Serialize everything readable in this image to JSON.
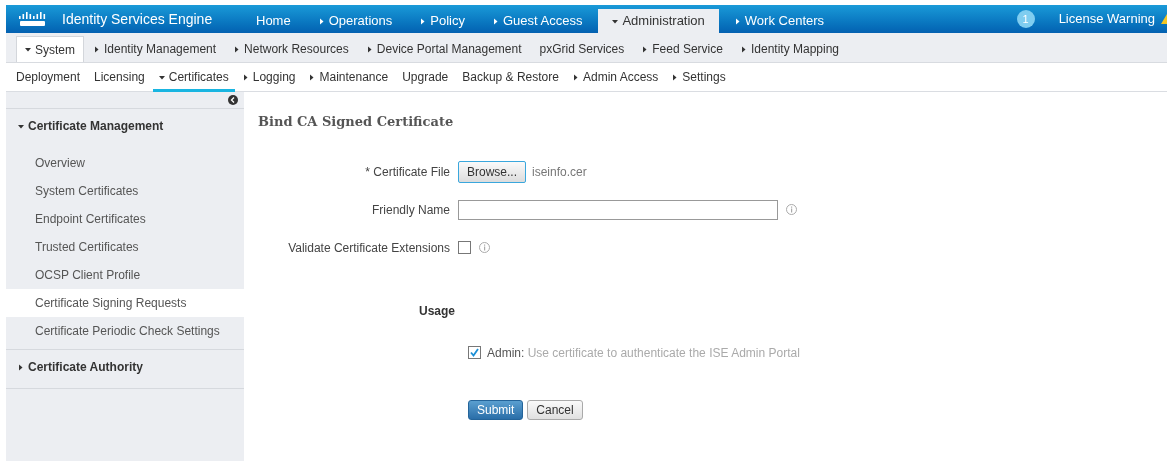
{
  "header": {
    "title": "Identity Services Engine",
    "tabs": [
      {
        "label": "Home",
        "kind": "link",
        "selected": false
      },
      {
        "label": "Operations",
        "kind": "menu",
        "expanded": false,
        "selected": false
      },
      {
        "label": "Policy",
        "kind": "menu",
        "expanded": false,
        "selected": false
      },
      {
        "label": "Guest Access",
        "kind": "menu",
        "expanded": false,
        "selected": false
      },
      {
        "label": "Administration",
        "kind": "menu",
        "expanded": true,
        "selected": true
      },
      {
        "label": "Work Centers",
        "kind": "menu",
        "expanded": false,
        "selected": false
      }
    ],
    "badge": "1",
    "license_warning": "License Warning"
  },
  "subnav": [
    {
      "label": "System",
      "kind": "menu",
      "expanded": true,
      "selected": true
    },
    {
      "label": "Identity Management",
      "kind": "menu",
      "expanded": false,
      "selected": false
    },
    {
      "label": "Network Resources",
      "kind": "menu",
      "expanded": false,
      "selected": false
    },
    {
      "label": "Device Portal Management",
      "kind": "menu",
      "expanded": false,
      "selected": false
    },
    {
      "label": "pxGrid Services",
      "kind": "link",
      "selected": false
    },
    {
      "label": "Feed Service",
      "kind": "menu",
      "expanded": false,
      "selected": false
    },
    {
      "label": "Identity Mapping",
      "kind": "menu",
      "expanded": false,
      "selected": false
    }
  ],
  "tabs": [
    {
      "label": "Deployment",
      "kind": "link",
      "selected": false
    },
    {
      "label": "Licensing",
      "kind": "link",
      "selected": false
    },
    {
      "label": "Certificates",
      "kind": "menu",
      "expanded": true,
      "selected": true
    },
    {
      "label": "Logging",
      "kind": "menu",
      "expanded": false,
      "selected": false
    },
    {
      "label": "Maintenance",
      "kind": "menu",
      "expanded": false,
      "selected": false
    },
    {
      "label": "Upgrade",
      "kind": "link",
      "selected": false
    },
    {
      "label": "Backup & Restore",
      "kind": "link",
      "selected": false
    },
    {
      "label": "Admin Access",
      "kind": "menu",
      "expanded": false,
      "selected": false
    },
    {
      "label": "Settings",
      "kind": "menu",
      "expanded": false,
      "selected": false
    }
  ],
  "sidebar": {
    "groups": [
      {
        "label": "Certificate Management",
        "expanded": true,
        "children": [
          {
            "label": "Overview",
            "selected": false
          },
          {
            "label": "System Certificates",
            "selected": false
          },
          {
            "label": "Endpoint Certificates",
            "selected": false
          },
          {
            "label": "Trusted Certificates",
            "selected": false
          },
          {
            "label": "OCSP Client Profile",
            "selected": false
          },
          {
            "label": "Certificate Signing Requests",
            "selected": true
          },
          {
            "label": "Certificate Periodic Check Settings",
            "selected": false
          }
        ]
      },
      {
        "label": "Certificate Authority",
        "expanded": false
      }
    ]
  },
  "form": {
    "title": "Bind CA Signed Certificate",
    "certificate_file": {
      "label": "* Certificate File",
      "button": "Browse...",
      "file": "iseinfo.cer"
    },
    "friendly_name": {
      "label": "Friendly Name"
    },
    "validate_extensions": {
      "label": "Validate Certificate Extensions",
      "checked": false
    },
    "usage": {
      "heading": "Usage",
      "admin": {
        "label": "**Admin:** Use certificate to authenticate the ISE Admin Portal",
        "checked": true
      }
    },
    "buttons": [
      {
        "label": "Submit",
        "kind": "primary"
      },
      {
        "label": "Cancel",
        "kind": "secondary"
      }
    ]
  }
}
